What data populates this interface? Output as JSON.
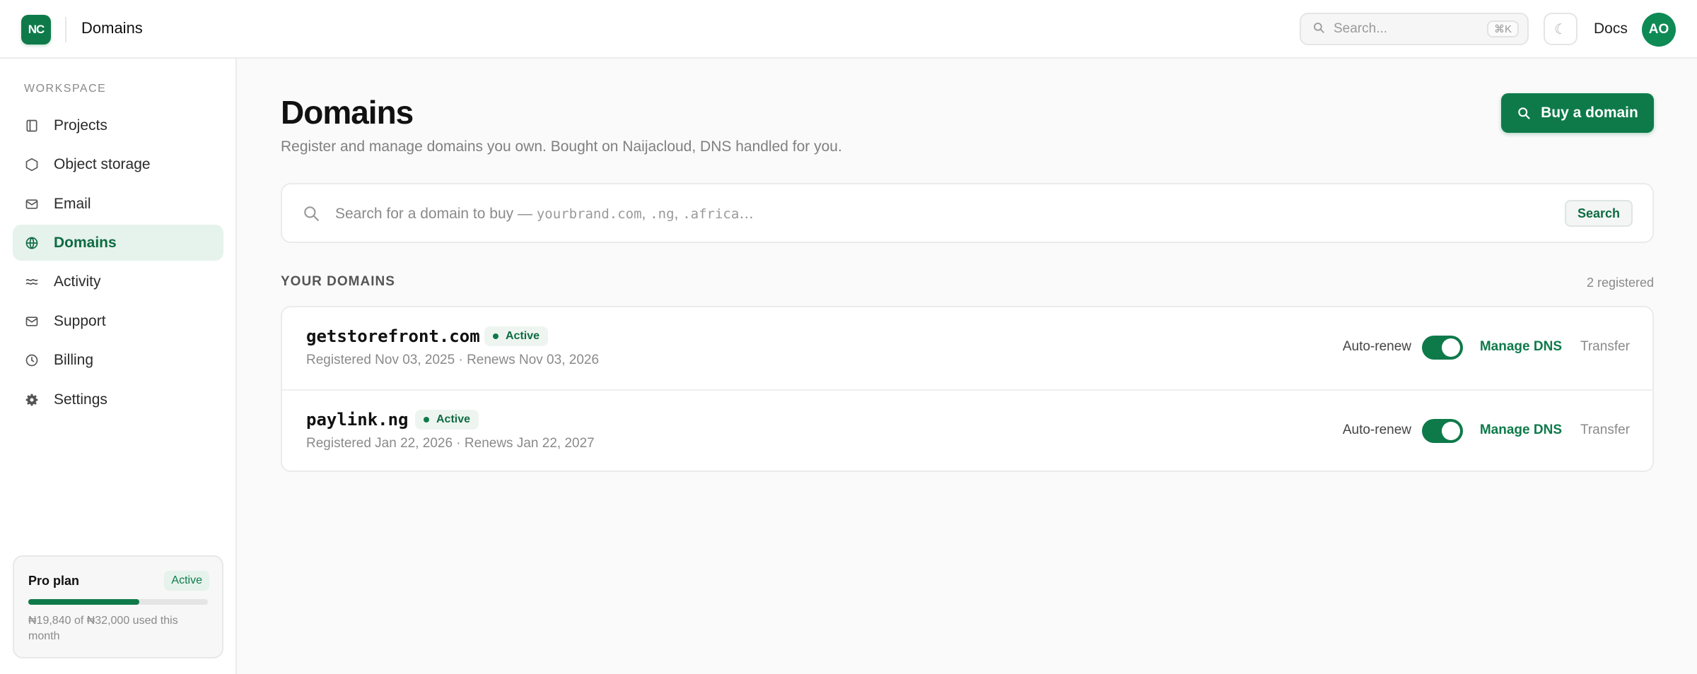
{
  "topbar": {
    "logo_text": "NC",
    "title": "Domains",
    "search_placeholder": "Search...",
    "search_shortcut": "⌘K",
    "theme_icon": "moon-icon",
    "docs_label": "Docs",
    "avatar_initials": "AO"
  },
  "sidebar": {
    "section_label": "WORKSPACE",
    "items": [
      {
        "label": "Projects",
        "icon": "folder-icon"
      },
      {
        "label": "Object storage",
        "icon": "hexagon-icon"
      },
      {
        "label": "Email",
        "icon": "mail-icon"
      },
      {
        "label": "Domains",
        "icon": "globe-icon",
        "active": true
      },
      {
        "label": "Activity",
        "icon": "activity-icon"
      },
      {
        "label": "Support",
        "icon": "support-mail-icon"
      },
      {
        "label": "Billing",
        "icon": "clock-icon"
      },
      {
        "label": "Settings",
        "icon": "gear-icon"
      }
    ],
    "plan": {
      "name": "Pro plan",
      "status": "Active",
      "usage_fraction": 0.62,
      "usage_text": "₦19,840 of ₦32,000 used this month"
    }
  },
  "main": {
    "title": "Domains",
    "subtitle": "Register and manage domains you own. Bought on Naijacloud, DNS handled for you.",
    "buy_button_label": "Buy a domain",
    "domain_search": {
      "placeholder_prefix": "Search for a domain to buy — ",
      "example_1": "yourbrand.com",
      "sep_1": ", ",
      "example_2": ".ng",
      "sep_2": ", ",
      "example_3": ".africa",
      "suffix": "…",
      "button_label": "Search"
    },
    "your_domains_heading": "YOUR DOMAINS",
    "registered_count": "2 registered",
    "domains": [
      {
        "name": "getstorefront.com",
        "status": "Active",
        "meta": "Registered Nov 03, 2025 · Renews Nov 03, 2026",
        "auto_renew_label": "Auto-renew",
        "auto_renew": true,
        "manage_dns_label": "Manage DNS",
        "transfer_label": "Transfer"
      },
      {
        "name": "paylink.ng",
        "status": "Active",
        "meta": "Registered Jan 22, 2026 · Renews Jan 22, 2027",
        "auto_renew_label": "Auto-renew",
        "auto_renew": true,
        "manage_dns_label": "Manage DNS",
        "transfer_label": "Transfer"
      }
    ]
  },
  "colors": {
    "brand": "#0e7a4a",
    "active_nav_bg": "#e6f2ec",
    "page_bg": "#fafafa"
  }
}
